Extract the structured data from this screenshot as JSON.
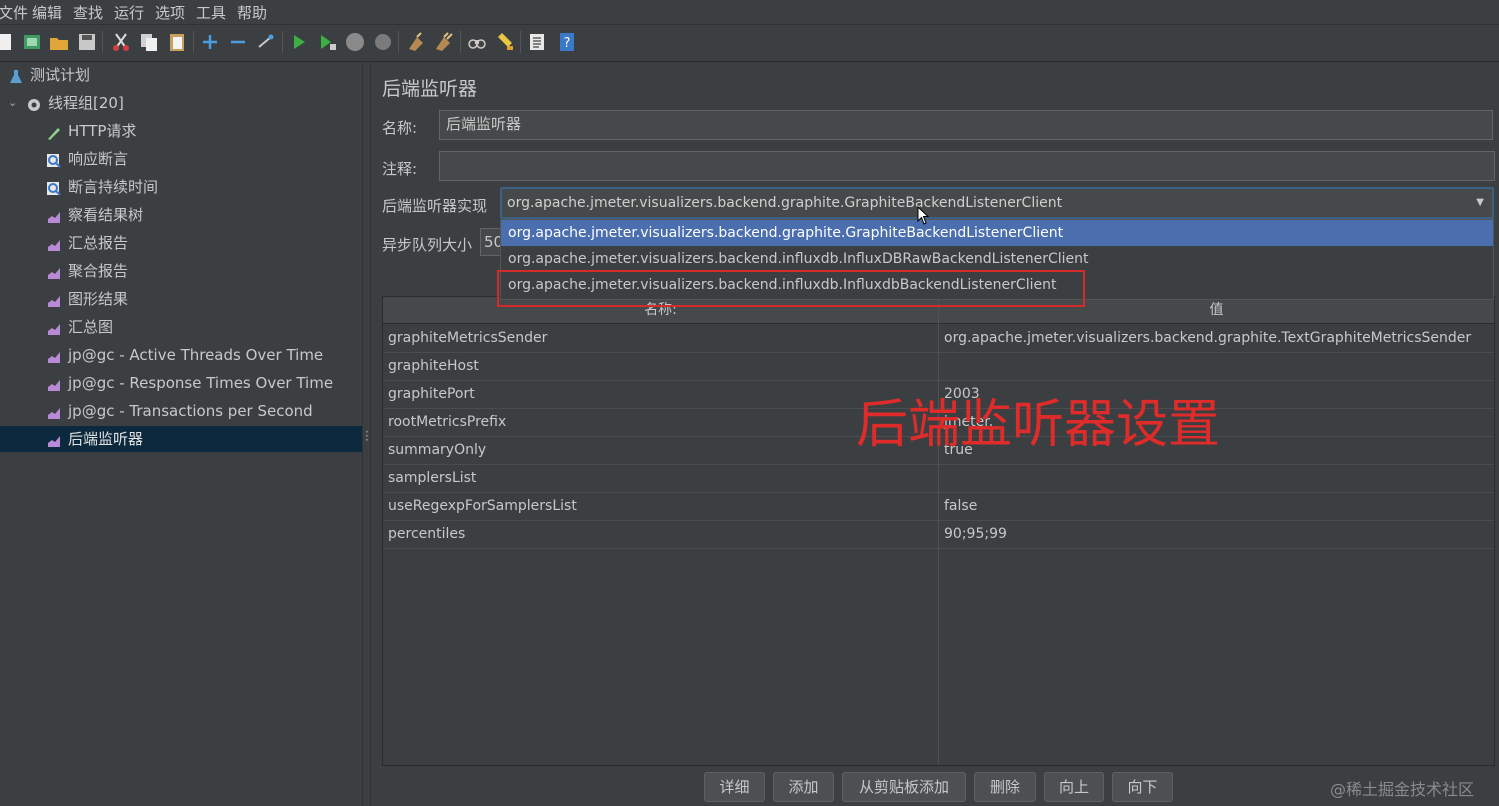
{
  "menubar": {
    "items": [
      "文件",
      "编辑",
      "查找",
      "运行",
      "选项",
      "工具",
      "帮助"
    ]
  },
  "toolbar": {
    "icons": [
      "new-icon",
      "templates-icon",
      "open-icon",
      "save-icon",
      "cut-icon",
      "copy-icon",
      "paste-icon",
      "expand-icon",
      "collapse-icon",
      "toggle-icon",
      "start-icon",
      "start-no-pause-icon",
      "stop-icon",
      "shutdown-icon",
      "clear-icon",
      "clear-all-icon",
      "search-icon",
      "reset-search-icon",
      "function-helper-icon",
      "help-icon"
    ]
  },
  "tree": {
    "items": [
      {
        "label": "测试计划",
        "icon": "flask-icon"
      },
      {
        "label": "线程组[20]",
        "icon": "gear-icon",
        "expander": "⌄"
      },
      {
        "label": "HTTP请求",
        "icon": "pen-icon"
      },
      {
        "label": "响应断言",
        "icon": "magnifier-icon"
      },
      {
        "label": "断言持续时间",
        "icon": "magnifier-icon"
      },
      {
        "label": "察看结果树",
        "icon": "chart-icon"
      },
      {
        "label": "汇总报告",
        "icon": "chart-icon"
      },
      {
        "label": "聚合报告",
        "icon": "chart-icon"
      },
      {
        "label": "图形结果",
        "icon": "chart-icon"
      },
      {
        "label": "汇总图",
        "icon": "chart-icon"
      },
      {
        "label": "jp@gc - Active Threads Over Time",
        "icon": "chart-icon"
      },
      {
        "label": "jp@gc - Response Times Over Time",
        "icon": "chart-icon"
      },
      {
        "label": "jp@gc - Transactions per Second",
        "icon": "chart-icon"
      },
      {
        "label": "后端监听器",
        "icon": "chart-icon",
        "selected": true
      }
    ]
  },
  "panel": {
    "title": "后端监听器",
    "name_label": "名称:",
    "name_value": "后端监听器",
    "comment_label": "注释:",
    "comment_value": "",
    "impl_label": "后端监听器实现",
    "impl_value": "org.apache.jmeter.visualizers.backend.graphite.GraphiteBackendListenerClient",
    "queue_label": "异步队列大小",
    "queue_value": "50",
    "dropdown_options": [
      "org.apache.jmeter.visualizers.backend.graphite.GraphiteBackendListenerClient",
      "org.apache.jmeter.visualizers.backend.influxdb.InfluxDBRawBackendListenerClient",
      "org.apache.jmeter.visualizers.backend.influxdb.InfluxdbBackendListenerClient"
    ]
  },
  "table": {
    "col_name": "名称:",
    "col_value": "值",
    "rows": [
      {
        "name": "graphiteMetricsSender",
        "value": "org.apache.jmeter.visualizers.backend.graphite.TextGraphiteMetricsSender"
      },
      {
        "name": "graphiteHost",
        "value": ""
      },
      {
        "name": "graphitePort",
        "value": "2003"
      },
      {
        "name": "rootMetricsPrefix",
        "value": "jmeter."
      },
      {
        "name": "summaryOnly",
        "value": "true"
      },
      {
        "name": "samplersList",
        "value": ""
      },
      {
        "name": "useRegexpForSamplersList",
        "value": "false"
      },
      {
        "name": "percentiles",
        "value": "90;95;99"
      }
    ]
  },
  "annotation": "后端监听器设置",
  "buttons": {
    "detail": "详细",
    "add": "添加",
    "add_clipboard": "从剪贴板添加",
    "delete": "删除",
    "up": "向上",
    "down": "向下"
  },
  "watermark": "@稀土掘金技术社区",
  "colors": {
    "background": "#3c3f41",
    "selection": "#4b6eaf",
    "tree_selection": "#0d293e",
    "highlight_red": "#d52a2a"
  }
}
